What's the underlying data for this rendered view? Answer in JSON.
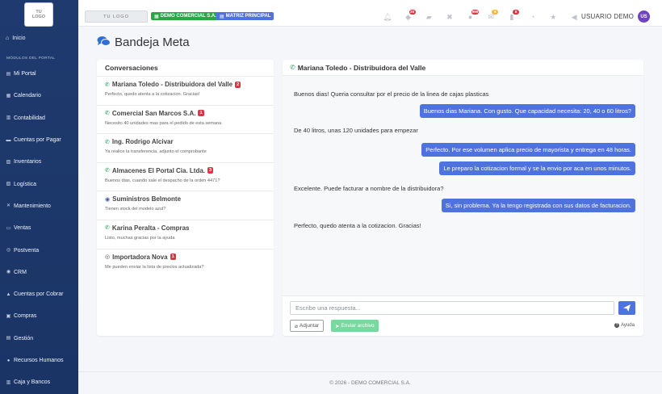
{
  "sidebar": {
    "logo_text": "TU LOGO",
    "home_label": "Inicio",
    "section_label": "MÓDULOS DEL PORTAL",
    "items": [
      {
        "label": "Mi Portal",
        "icon": "portal-icon"
      },
      {
        "label": "Calendario",
        "icon": "calendar-icon"
      },
      {
        "label": "Contabilidad",
        "icon": "accounting-icon"
      },
      {
        "label": "Cuentas por Pagar",
        "icon": "payables-icon"
      },
      {
        "label": "Inventarios",
        "icon": "inventory-icon"
      },
      {
        "label": "Logística",
        "icon": "logistics-icon"
      },
      {
        "label": "Mantenimiento",
        "icon": "maintenance-icon"
      },
      {
        "label": "Ventas",
        "icon": "sales-icon"
      },
      {
        "label": "Postventa",
        "icon": "postsale-icon"
      },
      {
        "label": "CRM",
        "icon": "crm-icon"
      },
      {
        "label": "Cuentas por Cobrar",
        "icon": "receivables-icon"
      },
      {
        "label": "Compras",
        "icon": "purchases-icon"
      },
      {
        "label": "Gestión",
        "icon": "management-icon"
      },
      {
        "label": "Recursos Humanos",
        "icon": "hr-icon"
      },
      {
        "label": "Caja y Bancos",
        "icon": "bank-icon"
      }
    ]
  },
  "topbar": {
    "logo_text": "TU LOGO",
    "company_badge": "DEMO COMERCIAL S.A.",
    "matrix_badge": "MATRIZ PRINCIPAL",
    "icons": [
      {
        "name": "bell-icon",
        "count": ""
      },
      {
        "name": "users-icon",
        "count": "20",
        "color": "#dc3545"
      },
      {
        "name": "truck-icon",
        "count": ""
      },
      {
        "name": "tools-icon",
        "count": ""
      },
      {
        "name": "people-icon",
        "count": "999",
        "color": "#dc3545"
      },
      {
        "name": "mail-icon",
        "count": "6",
        "color": "#f6b93b"
      },
      {
        "name": "chat-icon",
        "count": "8",
        "color": "#dc3545"
      },
      {
        "name": "clock-icon",
        "count": ""
      },
      {
        "name": "star-icon",
        "count": ""
      },
      {
        "name": "megaphone-icon",
        "count": ""
      }
    ],
    "user_name": "USUARIO DEMO",
    "user_initials": "US"
  },
  "page": {
    "title": "Bandeja Meta"
  },
  "conversations": {
    "header": "Conversaciones",
    "items": [
      {
        "name": "Mariana Toledo - Distribuidora del Valle",
        "channel": "whatsapp",
        "unread": "2",
        "preview": "Perfecto, quedo atenta a la cotizacion. Gracias!"
      },
      {
        "name": "Comercial San Marcos S.A.",
        "channel": "whatsapp",
        "unread": "1",
        "preview": "Necesito 40 unidades mas para el pedido de esta semana"
      },
      {
        "name": "Ing. Rodrigo Alcivar",
        "channel": "whatsapp",
        "unread": "",
        "preview": "Ya realice la transferencia, adjunto el comprobante"
      },
      {
        "name": "Almacenes El Portal Cia. Ltda.",
        "channel": "whatsapp",
        "unread": "3",
        "preview": "Buenos dias, cuando sale el despacho de la orden 4471?"
      },
      {
        "name": "Suministros Belmonte",
        "channel": "messenger",
        "unread": "",
        "preview": "Tienen stock del modelo azul?"
      },
      {
        "name": "Karina Peralta - Compras",
        "channel": "whatsapp",
        "unread": "",
        "preview": "Listo, muchas gracias por la ayuda"
      },
      {
        "name": "Importadora Nova",
        "channel": "instagram",
        "unread": "1",
        "preview": "Me pueden enviar la lista de precios actualizada?"
      }
    ]
  },
  "chat": {
    "contact": "Mariana Toledo - Distribuidora del Valle",
    "messages": [
      {
        "dir": "in",
        "text": "Buenos dias! Queria consultar por el precio de la linea de cajas plasticas"
      },
      {
        "dir": "out",
        "text": "Buenos dias Mariana. Con gusto. Que capacidad necesita: 20, 40 o 60 litros?"
      },
      {
        "dir": "in",
        "text": "De 40 litros, unas 120 unidades para empezar"
      },
      {
        "dir": "out",
        "text": "Perfecto. Por ese volumen aplica precio de mayorista y entrega en 48 horas."
      },
      {
        "dir": "out",
        "text": "Le preparo la cotizacion formal y se la envio por aca en unos minutos."
      },
      {
        "dir": "in",
        "text": "Excelente. Puede facturar a nombre de la distribuidora?"
      },
      {
        "dir": "out",
        "text": "Si, sin problema. Ya la tengo registrada con sus datos de facturacion."
      },
      {
        "dir": "in",
        "text": "Perfecto, quedo atenta a la cotizacion. Gracias!"
      }
    ],
    "input_placeholder": "Escribe una respuesta...",
    "attach_label": "Adjuntar",
    "file_label": "Enviar archivo",
    "help_label": "Ayuda"
  },
  "footer": {
    "text": "© 2026 - DEMO COMERCIAL S.A."
  },
  "colors": {
    "sidebar": "#1f3a6e",
    "accent": "#4e73df",
    "whatsapp": "#25a35a",
    "messenger": "#3b5998",
    "instagram": "#555555",
    "unread": "#dc3545",
    "company_badge": "#28a745"
  }
}
